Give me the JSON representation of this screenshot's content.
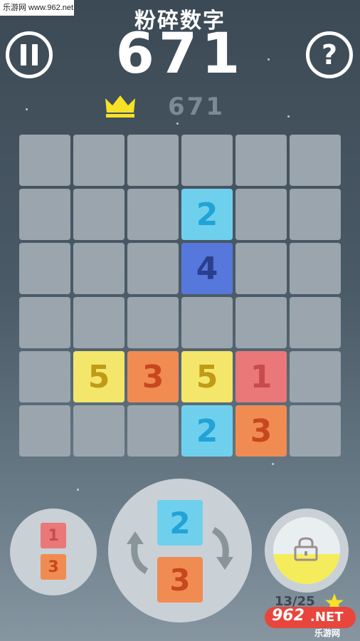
{
  "watermark": "乐游网 www.962.net",
  "title": "粉碎数字",
  "score": "671",
  "best_score": "671",
  "colors": {
    "tile_1": "#ea7878",
    "tile_2": "#6fd0ee",
    "tile_3": "#f08c52",
    "tile_4": "#5677dc",
    "tile_5": "#f3e66a",
    "empty_cell": "#9aa5ad",
    "crown": "#f7e227"
  },
  "icons": [
    "pause-icon",
    "help-icon",
    "crown-icon",
    "rotate-left-icon",
    "rotate-right-icon",
    "lock-icon",
    "star-icon"
  ],
  "help_symbol": "?",
  "board": {
    "rows": 6,
    "cols": 6,
    "tiles": [
      {
        "row": 1,
        "col": 3,
        "value": "2"
      },
      {
        "row": 2,
        "col": 3,
        "value": "4"
      },
      {
        "row": 4,
        "col": 1,
        "value": "5"
      },
      {
        "row": 4,
        "col": 2,
        "value": "3"
      },
      {
        "row": 4,
        "col": 3,
        "value": "5"
      },
      {
        "row": 4,
        "col": 4,
        "value": "1"
      },
      {
        "row": 5,
        "col": 3,
        "value": "2"
      },
      {
        "row": 5,
        "col": 4,
        "value": "3"
      }
    ]
  },
  "next_piece": {
    "top": "1",
    "bottom": "3"
  },
  "current_piece": {
    "top": "2",
    "bottom": "3"
  },
  "progress": {
    "text": "13/25",
    "fill_fraction": 0.45
  },
  "logo": {
    "brand": "962",
    "suffix": ".NET",
    "sub": "乐游网"
  }
}
